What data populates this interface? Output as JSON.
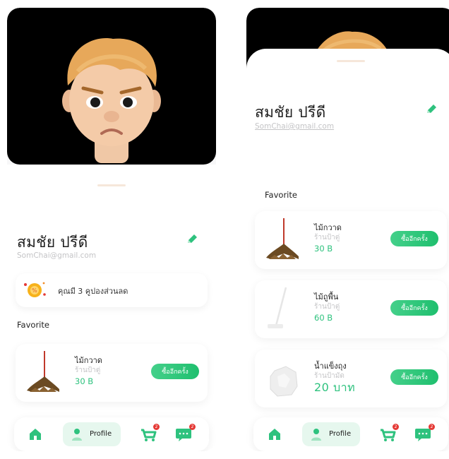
{
  "profile": {
    "name": "สมชัย ปรีดี",
    "email": "SomChai@gmail.com"
  },
  "coupon": {
    "text": "คุณมี 3 คูปองส่วนลด"
  },
  "favorite": {
    "title": "Favorite",
    "rebuy_label": "ซื้ออีกครั้ง",
    "items": [
      {
        "name": "ไม้กวาด",
        "shop": "ร้านป้าตู่",
        "price": "30 B",
        "icon": "broom-icon"
      },
      {
        "name": "ไม้ถูพื้น",
        "shop": "ร้านป้าตู่",
        "price": "60 B",
        "icon": "mop-icon"
      },
      {
        "name": "น้ำแข็งถุง",
        "shop": "ร้านป้ามัด",
        "price": "20 บาท",
        "icon": "ice-bag-icon"
      }
    ]
  },
  "nav": {
    "items": [
      {
        "icon": "home-icon"
      },
      {
        "icon": "profile-icon",
        "label": "Profile",
        "active": true
      },
      {
        "icon": "cart-icon",
        "badge": "2"
      },
      {
        "icon": "chat-icon",
        "badge": "2"
      }
    ]
  },
  "colors": {
    "accent": "#2ec27e",
    "active_nav_bg": "#e6f7ee",
    "badge": "#e53935",
    "avatar_bg": "#000000"
  }
}
